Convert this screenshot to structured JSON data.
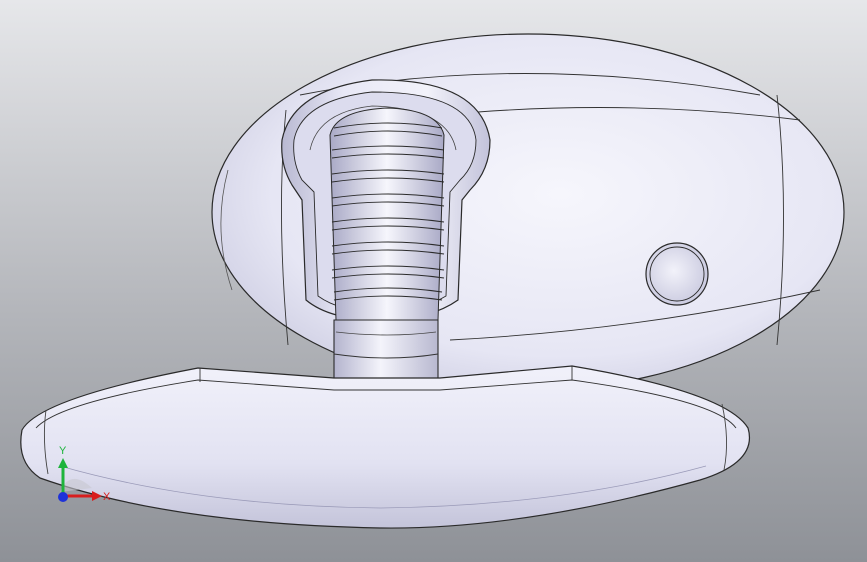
{
  "viewport": {
    "background_top": "#e4e5e8",
    "background_bottom": "#8e9197"
  },
  "model": {
    "body_color": "#e8e8f6",
    "edge_color": "#2a2a2a",
    "shadow_color": "#c6c6dc"
  },
  "triad": {
    "x_label": "X",
    "y_label": "Y",
    "x_color": "#d81e1e",
    "y_color": "#1eb43c",
    "z_color": "#1e32d8"
  }
}
